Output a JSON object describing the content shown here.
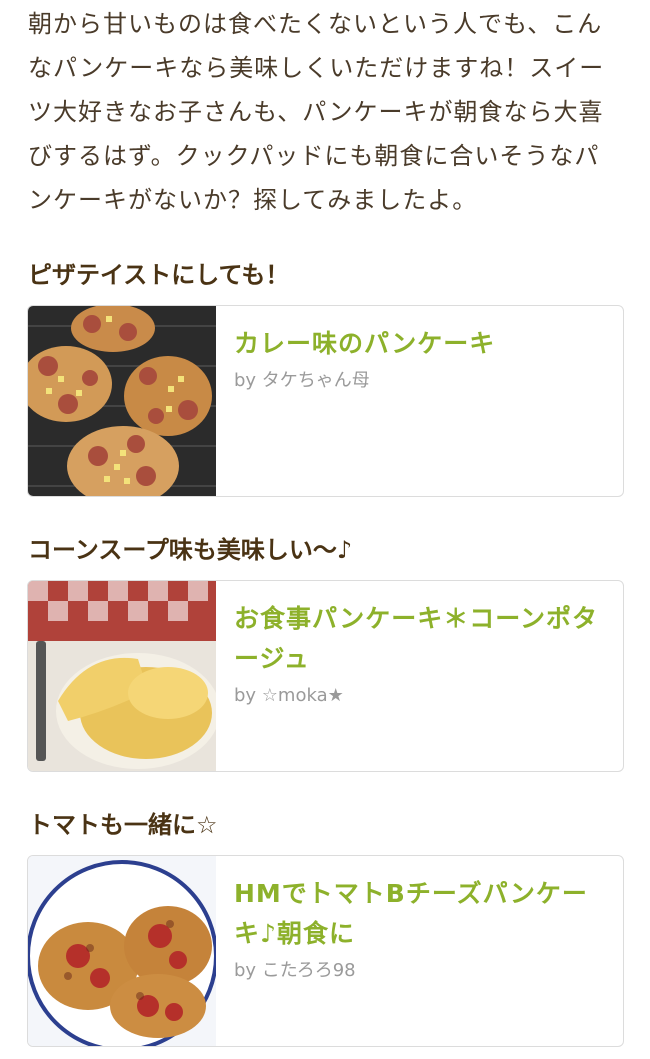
{
  "intro": {
    "lines": [
      "朝から甘いものは食べたくないという人でも、こん",
      "なパンケーキなら美味しくいただけますね！スイー",
      "ツ大好きなお子さんも、パンケーキが朝食なら大喜",
      "びするはず。クックパッドにも朝食に合いそうなパ",
      "ンケーキがないか？探してみましたよ。"
    ]
  },
  "sections": [
    {
      "heading": "ピザテイストにしても！",
      "recipe": {
        "title": "カレー味のパンケーキ",
        "author": "by タケちゃん母"
      }
    },
    {
      "heading": "コーンスープ味も美味しい〜♪",
      "recipe": {
        "title": "お食事パンケーキ＊コーンポタージュ",
        "author": "by ☆moka★"
      }
    },
    {
      "heading": "トマトも一緒に☆",
      "recipe": {
        "title": "HMでトマトBチーズパンケーキ♪朝食に",
        "author": "by こたろろ98"
      }
    }
  ],
  "colors": {
    "title": "#8db12b",
    "heading": "#4a3314",
    "byline": "#9a9a9a"
  },
  "thumbnails": [
    "pizza-pancake-photo",
    "corn-pancake-photo",
    "tomato-pancake-photo"
  ]
}
